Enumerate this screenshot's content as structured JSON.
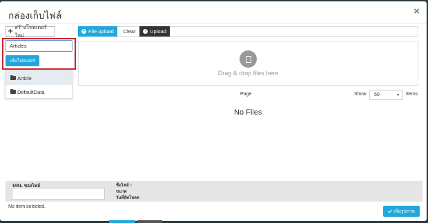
{
  "dialog": {
    "title": "กล่องเก็บไฟล์",
    "close_label": "×"
  },
  "sidebar": {
    "new_folder_label": "สร้างโฟลเดอร์ใหม่",
    "folder_name_value": "Articles",
    "add_folder_label": "เพิ่มโฟลเดอร์",
    "folders": [
      {
        "label": "Article",
        "icon": "folder-open-icon",
        "active": true
      },
      {
        "label": "DefaultData",
        "icon": "folder-icon",
        "active": false
      }
    ]
  },
  "toolbar": {
    "file_upload_label": "File upload",
    "clear_label": "Clear",
    "upload_label": "Upload"
  },
  "dropzone": {
    "text": "Drag & drop files here",
    "icon": "file-icon"
  },
  "pagination": {
    "page_label": "Page",
    "show_label": "Show",
    "show_value": "50",
    "items_label": "Items"
  },
  "file_list": {
    "empty_text": "No Files"
  },
  "details": {
    "url_label": "URL ของไฟล์",
    "name_label": "ชื่อไฟล์ :",
    "size_label": "ขนาด",
    "date_label": "วันที่อัพโหลด"
  },
  "footer": {
    "status_text": "No item selected.",
    "add_image_label": "เพิ่มรูปภาพ"
  },
  "colors": {
    "accent": "#22a7db",
    "dark_button": "#333333",
    "highlight_border": "#c9232d",
    "panel_bg": "#e5e5e5"
  }
}
